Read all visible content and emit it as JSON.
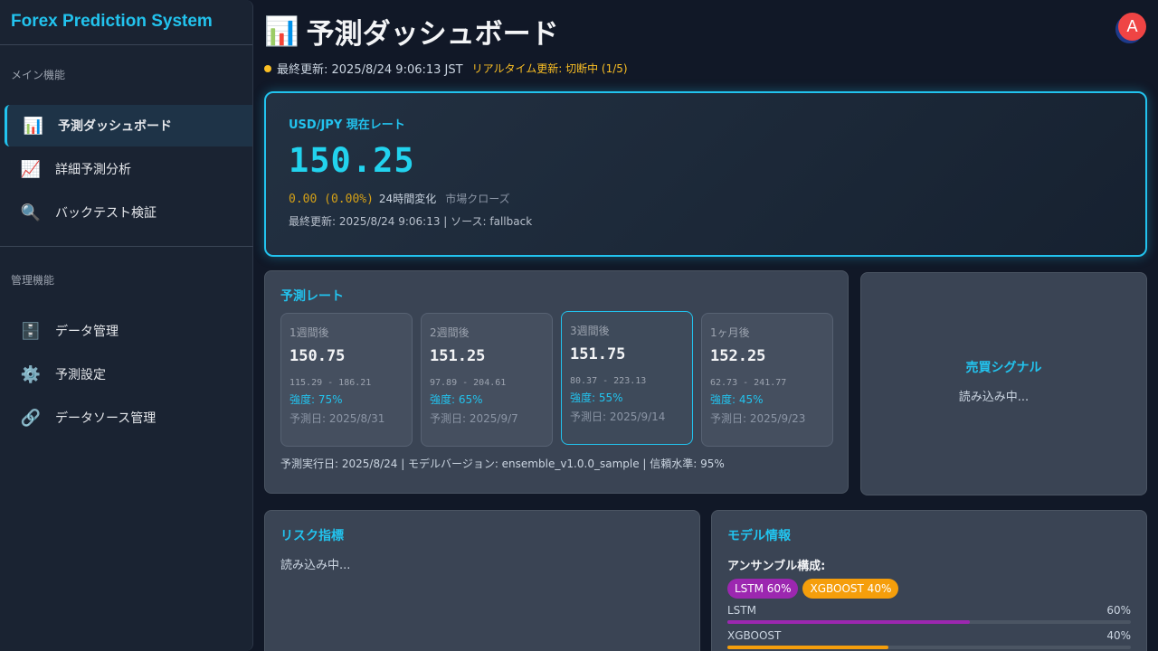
{
  "sidebar": {
    "brand": "Forex Prediction System",
    "sections": [
      {
        "label": "メイン機能",
        "items": [
          {
            "icon": "📊",
            "icon_name": "bar-chart-icon",
            "label": "予測ダッシュボード",
            "active": true
          },
          {
            "icon": "📈",
            "icon_name": "trend-chart-icon",
            "label": "詳細予測分析"
          },
          {
            "icon": "🔍",
            "icon_name": "magnifier-icon",
            "label": "バックテスト検証"
          }
        ]
      },
      {
        "label": "管理機能",
        "items": [
          {
            "icon": "🗄️",
            "icon_name": "file-cabinet-icon",
            "label": "データ管理"
          },
          {
            "icon": "⚙️",
            "icon_name": "gear-icon",
            "label": "予測設定"
          },
          {
            "icon": "🔗",
            "icon_name": "link-icon",
            "label": "データソース管理"
          }
        ]
      }
    ]
  },
  "header": {
    "icon": "📊",
    "title": "予測ダッシュボード",
    "avatar": "A",
    "last_updated": "最終更新: 2025/8/24 9:06:13 JST",
    "realtime": "リアルタイム更新: 切断中 (1/5)"
  },
  "rate_card": {
    "pair": "USD/JPY 現在レート",
    "rate": "150.25",
    "change": "0.00 (0.00%)",
    "change_label": "24時間変化",
    "market_status": "市場クローズ",
    "updated": "最終更新: 2025/8/24 9:06:13 | ソース: fallback"
  },
  "predictions": {
    "title": "予測レート",
    "cards": [
      {
        "period": "1週間後",
        "rate": "150.75",
        "range": "115.29 - 186.21",
        "strength": "強度: 75%",
        "date": "予測日: 2025/8/31",
        "highlight": false
      },
      {
        "period": "2週間後",
        "rate": "151.25",
        "range": "97.89 - 204.61",
        "strength": "強度: 65%",
        "date": "予測日: 2025/9/7",
        "highlight": false
      },
      {
        "period": "3週間後",
        "rate": "151.75",
        "range": "80.37 - 223.13",
        "strength": "強度: 55%",
        "date": "予測日: 2025/9/14",
        "highlight": true
      },
      {
        "period": "1ヶ月後",
        "rate": "152.25",
        "range": "62.73 - 241.77",
        "strength": "強度: 45%",
        "date": "予測日: 2025/9/23",
        "highlight": false
      }
    ],
    "meta": "予測実行日: 2025/8/24 | モデルバージョン: ensemble_v1.0.0_sample | 信頼水準: 95%"
  },
  "signal": {
    "title": "売買シグナル",
    "loading": "読み込み中..."
  },
  "risk": {
    "title": "リスク指標",
    "loading": "読み込み中..."
  },
  "model": {
    "title": "モデル情報",
    "ensemble_label": "アンサンブル構成:",
    "chips": [
      {
        "label": "LSTM 60%",
        "color": "#9c27b0"
      },
      {
        "label": "XGBOOST 40%",
        "color": "#f59e0b"
      }
    ],
    "bars": [
      {
        "name": "LSTM",
        "percent_label": "60%",
        "value": 0.6,
        "color": "#9c27b0"
      },
      {
        "name": "XGBOOST",
        "percent_label": "40%",
        "value": 0.4,
        "color": "#f59e0b"
      }
    ]
  }
}
